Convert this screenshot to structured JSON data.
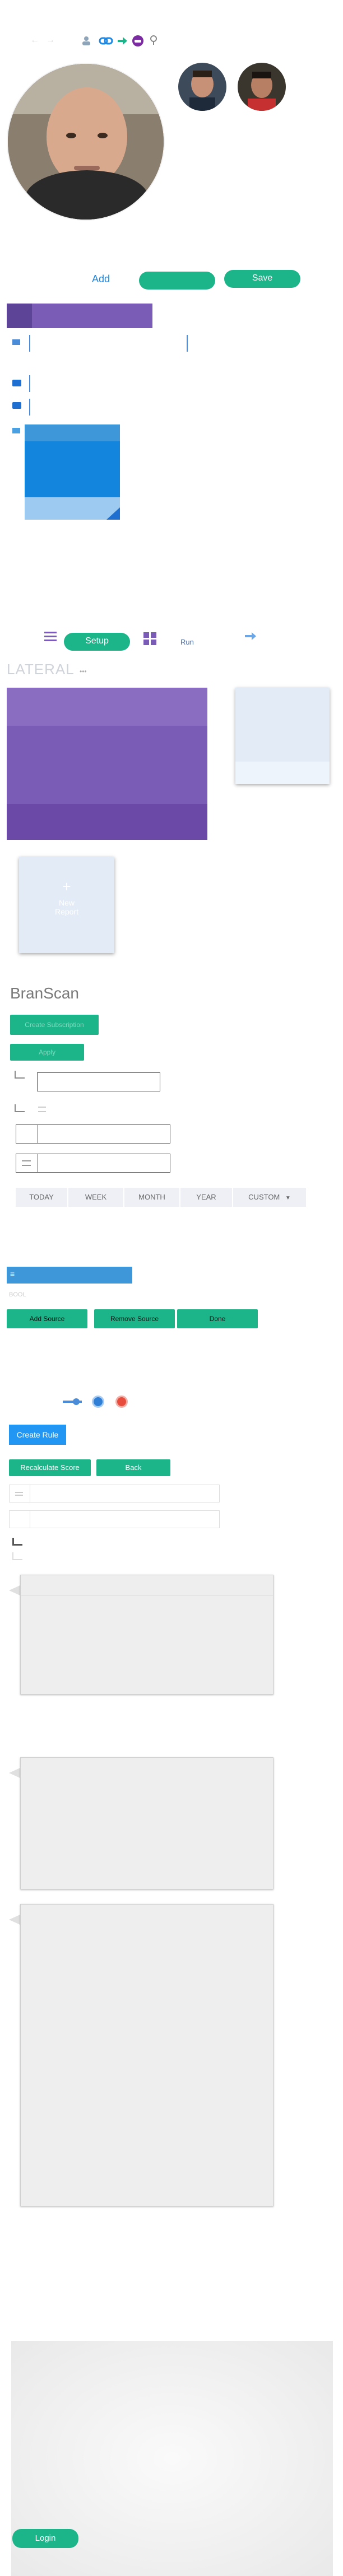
{
  "top_toolbar": {
    "icons": [
      "back-icon",
      "forward-icon",
      "user-icon",
      "link-icon",
      "arrow-right-icon",
      "avatar-mini-icon",
      "pin-icon"
    ]
  },
  "profile": {
    "add_label": "Add",
    "save_label": "Save"
  },
  "nav": {
    "setup_label": "Setup",
    "run_label": "Run"
  },
  "lateral": {
    "title": "LATERAL",
    "dots": "•••"
  },
  "new_report": {
    "label_line1": "New",
    "label_line2": "Report",
    "plus": "+"
  },
  "branscan": {
    "title": "BranScan",
    "btn_top": "Create Subscription",
    "btn_second": "Apply"
  },
  "time_range": {
    "options": [
      "TODAY",
      "WEEK",
      "MONTH",
      "YEAR",
      "CUSTOM"
    ]
  },
  "blue_bar": {
    "label": "≡",
    "sub_label": "BOOL"
  },
  "actions": {
    "add_source": "Add Source",
    "remove_source": "Remove Source",
    "done": "Done"
  },
  "rules": {
    "create_rule": "Create Rule",
    "recalculate": "Recalculate Score",
    "back": "Back"
  },
  "login": {
    "label": "Login"
  },
  "colors": {
    "green": "#1cb58a",
    "purple": "#7a5bb5",
    "blue": "#1e88e5",
    "red": "#e74c3c"
  }
}
